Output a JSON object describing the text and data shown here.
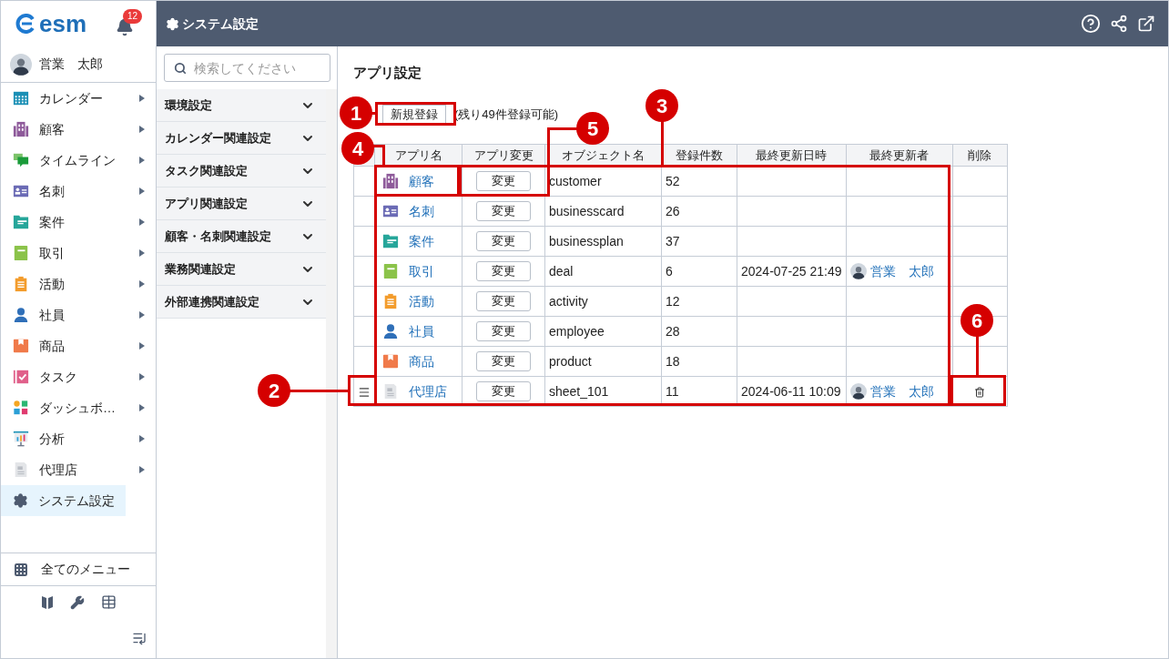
{
  "app": {
    "logo": "esm",
    "notification_count": "12"
  },
  "user": {
    "name": "営業　太郎"
  },
  "nav": [
    {
      "label": "カレンダー",
      "has_submenu": true,
      "selected": false
    },
    {
      "label": "顧客",
      "has_submenu": true,
      "selected": false
    },
    {
      "label": "タイムライン",
      "has_submenu": true,
      "selected": false
    },
    {
      "label": "名刺",
      "has_submenu": true,
      "selected": false
    },
    {
      "label": "案件",
      "has_submenu": true,
      "selected": false
    },
    {
      "label": "取引",
      "has_submenu": true,
      "selected": false
    },
    {
      "label": "活動",
      "has_submenu": true,
      "selected": false
    },
    {
      "label": "社員",
      "has_submenu": true,
      "selected": false
    },
    {
      "label": "商品",
      "has_submenu": true,
      "selected": false
    },
    {
      "label": "タスク",
      "has_submenu": true,
      "selected": false
    },
    {
      "label": "ダッシュボ…",
      "has_submenu": true,
      "selected": false
    },
    {
      "label": "分析",
      "has_submenu": true,
      "selected": false
    },
    {
      "label": "代理店",
      "has_submenu": true,
      "selected": false
    },
    {
      "label": "システム設定",
      "has_submenu": false,
      "selected": true
    }
  ],
  "all_menu": "全てのメニュー",
  "header": {
    "title": "システム設定"
  },
  "search": {
    "placeholder": "検索してください"
  },
  "settings_groups": [
    {
      "label": "環境設定",
      "expanded": false
    },
    {
      "label": "カレンダー関連設定",
      "expanded": false
    },
    {
      "label": "タスク関連設定",
      "expanded": false
    },
    {
      "label": "アプリ関連設定",
      "expanded": false
    },
    {
      "label": "顧客・名刺関連設定",
      "expanded": false
    },
    {
      "label": "業務関連設定",
      "expanded": false
    },
    {
      "label": "外部連携関連設定",
      "expanded": false
    }
  ],
  "page": {
    "title": "アプリ設定",
    "new_button": "新規登録",
    "remaining": "(残り49件登録可能)"
  },
  "table": {
    "columns": [
      "アプリ名",
      "アプリ変更",
      "オブジェクト名",
      "登録件数",
      "最終更新日時",
      "最終更新者",
      "削除"
    ],
    "rows": [
      {
        "app_name": "顧客",
        "change": "変更",
        "object_name": "customer",
        "count": "52",
        "hovered": false
      },
      {
        "app_name": "名刺",
        "change": "変更",
        "object_name": "businesscard",
        "count": "26",
        "hovered": false
      },
      {
        "app_name": "案件",
        "change": "変更",
        "object_name": "businessplan",
        "count": "37",
        "hovered": false
      },
      {
        "app_name": "取引",
        "change": "変更",
        "object_name": "deal",
        "count": "6",
        "updated_at": "2024-07-25 21:49",
        "updated_by": "営業　太郎",
        "hovered": false
      },
      {
        "app_name": "活動",
        "change": "変更",
        "object_name": "activity",
        "count": "12",
        "hovered": false
      },
      {
        "app_name": "社員",
        "change": "変更",
        "object_name": "employee",
        "count": "28",
        "hovered": false
      },
      {
        "app_name": "商品",
        "change": "変更",
        "object_name": "product",
        "count": "18",
        "hovered": false
      },
      {
        "app_name": "代理店",
        "change": "変更",
        "object_name": "sheet_101",
        "count": "11",
        "updated_at": "2024-06-11 10:09",
        "updated_by": "営業　太郎",
        "hovered": true
      }
    ]
  },
  "callouts": [
    {
      "number": "1"
    },
    {
      "number": "2"
    },
    {
      "number": "3"
    },
    {
      "number": "4"
    },
    {
      "number": "5"
    },
    {
      "number": "6"
    }
  ]
}
